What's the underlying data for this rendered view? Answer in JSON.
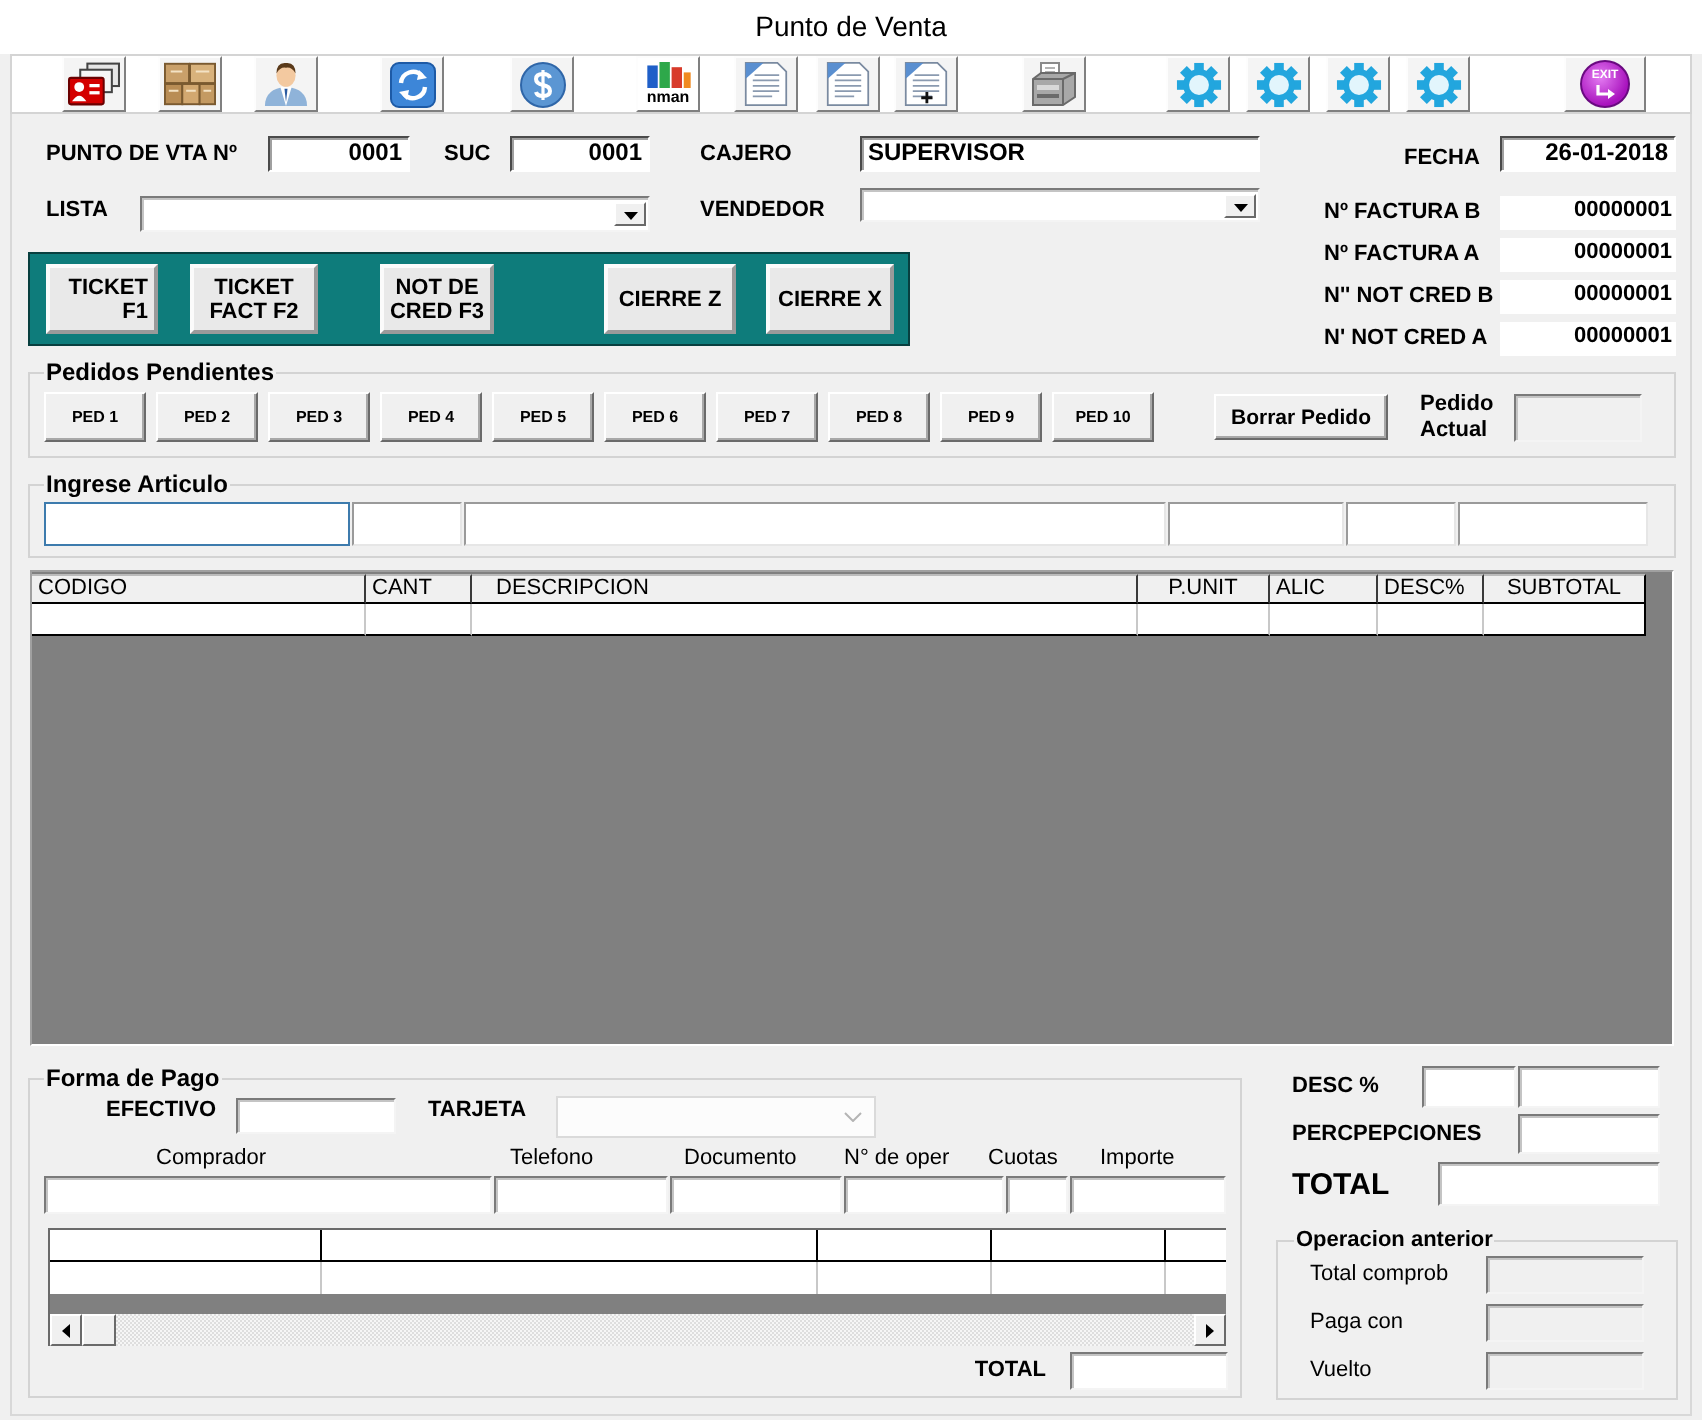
{
  "window": {
    "title": "Punto de Venta"
  },
  "toolbar": [
    {
      "kind": "id-card"
    },
    {
      "kind": "boxes"
    },
    {
      "kind": "person"
    },
    {
      "kind": "refresh"
    },
    {
      "kind": "dollar"
    },
    {
      "kind": "chart",
      "label": "nman"
    },
    {
      "kind": "document"
    },
    {
      "kind": "document"
    },
    {
      "kind": "document-plus"
    },
    {
      "kind": "printer"
    },
    {
      "kind": "gear"
    },
    {
      "kind": "gear"
    },
    {
      "kind": "gear"
    },
    {
      "kind": "gear"
    },
    {
      "kind": "exit",
      "label": "EXIT"
    }
  ],
  "header": {
    "point_of_sale": {
      "label": "PUNTO DE VTA Nº",
      "value": "0001"
    },
    "branch": {
      "label": "SUC",
      "value": "0001"
    },
    "cashier": {
      "label": "CAJERO",
      "value": "SUPERVISOR"
    },
    "price_list": {
      "label": "LISTA"
    },
    "seller": {
      "label": "VENDEDOR"
    }
  },
  "invoice_info": {
    "date": {
      "label": "FECHA",
      "value": "26-01-2018"
    },
    "counters": [
      {
        "label": "Nº FACTURA B",
        "value": "00000001"
      },
      {
        "label": "Nº FACTURA A",
        "value": "00000001"
      },
      {
        "label": "N'' NOT CRED B",
        "value": "00000001"
      },
      {
        "label": "N' NOT CRED A",
        "value": "00000001"
      }
    ]
  },
  "document_buttons": [
    {
      "lines": [
        "TICKET",
        "F1"
      ]
    },
    {
      "lines": [
        "TICKET",
        "FACT F2"
      ]
    },
    {
      "lines": [
        "NOT DE",
        "CRED F3"
      ]
    },
    {
      "lines": [
        "CIERRE Z"
      ]
    },
    {
      "lines": [
        "CIERRE X"
      ]
    }
  ],
  "pending_orders": {
    "title": "Pedidos Pendientes",
    "orders": [
      "PED 1",
      "PED 2",
      "PED 3",
      "PED 4",
      "PED 5",
      "PED 6",
      "PED 7",
      "PED 8",
      "PED 9",
      "PED 10"
    ],
    "delete_button": "Borrar Pedido",
    "current": {
      "label": "Pedido Actual",
      "disabled": true
    }
  },
  "article_entry": {
    "title": "Ingrese Articulo",
    "fields": [
      {
        "focused": true
      },
      {
        "focused": false
      },
      {
        "focused": false
      },
      {
        "focused": false
      },
      {
        "focused": false
      },
      {
        "focused": false
      }
    ]
  },
  "items_table": {
    "columns": [
      "CODIGO",
      "CANT",
      "DESCRIPCION",
      "P.UNIT",
      "ALIC",
      "DESC%",
      "SUBTOTAL"
    ]
  },
  "payment": {
    "title": "Forma de Pago",
    "cash": {
      "label": "EFECTIVO"
    },
    "card": {
      "label": "TARJETA",
      "disabled": true
    },
    "card_fields": [
      {
        "label": "Comprador"
      },
      {
        "label": "Telefono"
      },
      {
        "label": "Documento"
      },
      {
        "label": "N° de oper"
      },
      {
        "label": "Cuotas"
      },
      {
        "label": "Importe"
      }
    ],
    "total": {
      "label": "TOTAL"
    }
  },
  "totals": {
    "discount": {
      "label": "DESC %"
    },
    "perceptions": {
      "label": "PERCPEPCIONES"
    },
    "total": {
      "label": "TOTAL"
    }
  },
  "previous_operation": {
    "title": "Operacion anterior",
    "rows": [
      {
        "label": "Total comprob",
        "disabled": true
      },
      {
        "label": "Paga con",
        "disabled": true
      },
      {
        "label": "Vuelto",
        "disabled": true
      }
    ]
  }
}
